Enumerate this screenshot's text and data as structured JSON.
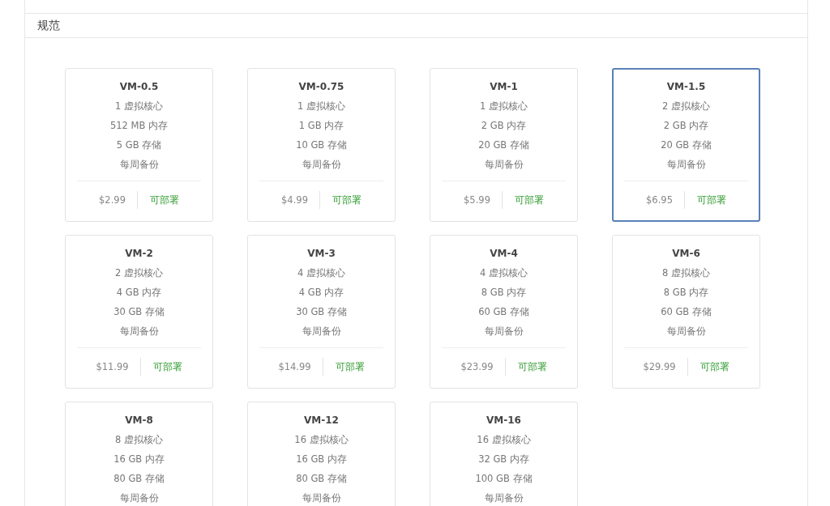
{
  "section": {
    "title": "规范"
  },
  "plans": [
    {
      "name": "VM-0.5",
      "specs": [
        "1 虚拟核心",
        "512 MB 内存",
        "5 GB 存储",
        "每周备份"
      ],
      "price": "$2.99",
      "status": "可部署",
      "selected": false
    },
    {
      "name": "VM-0.75",
      "specs": [
        "1 虚拟核心",
        "1 GB 内存",
        "10 GB 存储",
        "每周备份"
      ],
      "price": "$4.99",
      "status": "可部署",
      "selected": false
    },
    {
      "name": "VM-1",
      "specs": [
        "1 虚拟核心",
        "2 GB 内存",
        "20 GB 存储",
        "每周备份"
      ],
      "price": "$5.99",
      "status": "可部署",
      "selected": false
    },
    {
      "name": "VM-1.5",
      "specs": [
        "2 虚拟核心",
        "2 GB 内存",
        "20 GB 存储",
        "每周备份"
      ],
      "price": "$6.95",
      "status": "可部署",
      "selected": true
    },
    {
      "name": "VM-2",
      "specs": [
        "2 虚拟核心",
        "4 GB 内存",
        "30 GB 存储",
        "每周备份"
      ],
      "price": "$11.99",
      "status": "可部署",
      "selected": false
    },
    {
      "name": "VM-3",
      "specs": [
        "4 虚拟核心",
        "4 GB 内存",
        "30 GB 存储",
        "每周备份"
      ],
      "price": "$14.99",
      "status": "可部署",
      "selected": false
    },
    {
      "name": "VM-4",
      "specs": [
        "4 虚拟核心",
        "8 GB 内存",
        "60 GB 存储",
        "每周备份"
      ],
      "price": "$23.99",
      "status": "可部署",
      "selected": false
    },
    {
      "name": "VM-6",
      "specs": [
        "8 虚拟核心",
        "8 GB 内存",
        "60 GB 存储",
        "每周备份"
      ],
      "price": "$29.99",
      "status": "可部署",
      "selected": false
    },
    {
      "name": "VM-8",
      "specs": [
        "8 虚拟核心",
        "16 GB 内存",
        "80 GB 存储",
        "每周备份"
      ],
      "selected": false
    },
    {
      "name": "VM-12",
      "specs": [
        "16 虚拟核心",
        "16 GB 内存",
        "80 GB 存储",
        "每周备份"
      ],
      "selected": false
    },
    {
      "name": "VM-16",
      "specs": [
        "16 虚拟核心",
        "32 GB 内存",
        "100 GB 存储",
        "每周备份"
      ],
      "selected": false
    }
  ]
}
